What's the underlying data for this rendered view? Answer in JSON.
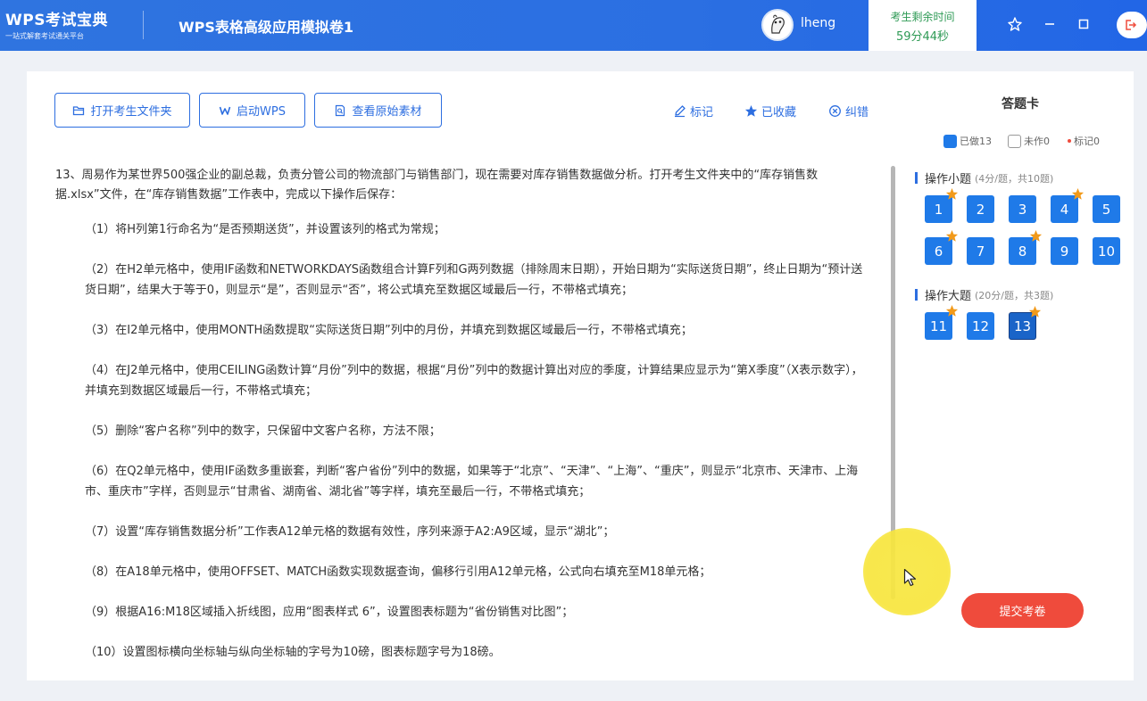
{
  "header": {
    "brand_name": "WPS考试宝典",
    "brand_sub": "一站式解套考试通关平台",
    "exam_title": "WPS表格高级应用模拟卷1",
    "username": "lheng",
    "timer_label": "考生剩余时间",
    "timer_value": "59分44秒",
    "icons": [
      "pin-icon",
      "minimize-icon",
      "maximize-icon",
      "exit-icon"
    ]
  },
  "toolbar": {
    "open_folder": "打开考生文件夹",
    "launch_wps": "启动WPS",
    "view_material": "查看原始素材",
    "mark": "标记",
    "favorited": "已收藏",
    "report_error": "纠错"
  },
  "question": {
    "intro": "13、周易作为某世界500强企业的副总裁，负责分管公司的物流部门与销售部门，现在需要对库存销售数据做分析。打开考生文件夹中的“库存销售数据.xlsx”文件，在“库存销售数据”工作表中，完成以下操作后保存：",
    "items": [
      "（1）将H列第1行命名为“是否预期送货”，并设置该列的格式为常规；",
      "（2）在H2单元格中，使用IF函数和NETWORKDAYS函数组合计算F列和G两列数据（排除周末日期），开始日期为“实际送货日期”，终止日期为“预计送货日期”，结果大于等于0，则显示“是”，否则显示“否”，将公式填充至数据区域最后一行，不带格式填充；",
      "（3）在I2单元格中，使用MONTH函数提取“实际送货日期”列中的月份，并填充到数据区域最后一行，不带格式填充；",
      "（4）在J2单元格中，使用CEILING函数计算“月份”列中的数据，根据“月份”列中的数据计算出对应的季度，计算结果应显示为“第X季度”（X表示数字），并填充到数据区域最后一行，不带格式填充；",
      "（5）删除“客户名称”列中的数字，只保留中文客户名称，方法不限；",
      "（6）在Q2单元格中，使用IF函数多重嵌套，判断“客户省份”列中的数据，如果等于“北京”、“天津”、“上海”、“重庆”，则显示“北京市、天津市、上海市、重庆市”字样，否则显示“甘肃省、湖南省、湖北省”等字样，填充至最后一行，不带格式填充；",
      "（7）设置“库存销售数据分析”工作表A12单元格的数据有效性，序列来源于A2:A9区域，显示“湖北”；",
      "（8）在A18单元格中，使用OFFSET、MATCH函数实现数据查询，偏移行引用A12单元格，公式向右填充至M18单元格；",
      "（9）根据A16:M18区域插入折线图，应用“图表样式 6”，设置图表标题为“省份销售对比图”；",
      "（10）设置图标横向坐标轴与纵向坐标轴的字号为10磅，图表标题字号为18磅。"
    ]
  },
  "answer_card": {
    "title": "答题卡",
    "legend_done": "已做13",
    "legend_undone": "未作0",
    "legend_marked": "标记0",
    "section1_title": "操作小题",
    "section1_hint": "(4分/题，共10题)",
    "section2_title": "操作大题",
    "section2_hint": "(20分/题，共3题)",
    "section1_numbers": [
      "1",
      "2",
      "3",
      "4",
      "5",
      "6",
      "7",
      "8",
      "9",
      "10"
    ],
    "section2_numbers": [
      "11",
      "12",
      "13"
    ],
    "starred": [
      "1",
      "4",
      "6",
      "8",
      "11",
      "13"
    ],
    "current": "13",
    "submit": "提交考卷"
  },
  "colors": {
    "primary": "#2d6ee0",
    "question_button": "#1f7ae8",
    "star": "#f29a1a",
    "submit": "#ef4b3c",
    "timer_text": "#2e9a55"
  }
}
